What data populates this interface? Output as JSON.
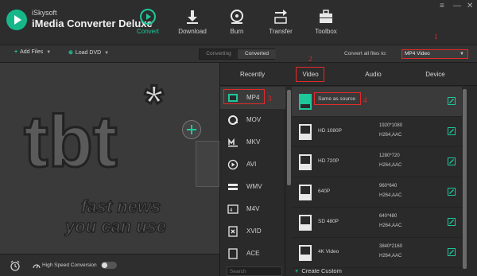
{
  "app": {
    "brand_small": "iSkysoft",
    "brand_big": "iMedia Converter Deluxe",
    "window_controls": [
      "≡",
      "—",
      "✕"
    ]
  },
  "nav": {
    "tabs": [
      {
        "label": "Convert",
        "icon": "convert-icon",
        "active": true
      },
      {
        "label": "Download",
        "icon": "download-icon"
      },
      {
        "label": "Burn",
        "icon": "burn-icon"
      },
      {
        "label": "Transfer",
        "icon": "transfer-icon"
      },
      {
        "label": "Toolbox",
        "icon": "toolbox-icon"
      }
    ]
  },
  "toolbar": {
    "add_files": "Add Files",
    "load_dvd": "Load DVD",
    "converting": "Converting",
    "converted": "Converted",
    "convert_all_label": "Convert all files to:",
    "format_value": "MP4 Video"
  },
  "preview": {
    "logo_text_1": "tbt",
    "logo_text_2": "fast news",
    "logo_text_3": "you can use"
  },
  "panel": {
    "tabs": [
      "Recently",
      "Video",
      "Audio",
      "Device"
    ],
    "formats": [
      {
        "label": "MP4",
        "icon": "mp4-film-icon",
        "selected": true
      },
      {
        "label": "MOV",
        "icon": "mov-icon"
      },
      {
        "label": "MKV",
        "icon": "mkv-icon"
      },
      {
        "label": "AVI",
        "icon": "avi-icon"
      },
      {
        "label": "WMV",
        "icon": "wmv-icon"
      },
      {
        "label": "M4V",
        "icon": "m4v-icon"
      },
      {
        "label": "XVID",
        "icon": "xvid-icon"
      },
      {
        "label": "ACE",
        "icon": "ace-icon"
      }
    ],
    "resolutions": [
      {
        "label": "Same as source",
        "res": "",
        "codec": "",
        "badge": "SOURCE",
        "selected": true
      },
      {
        "label": "HD 1080P",
        "res": "1920*1080",
        "codec": "H264,AAC",
        "badge": "1080P"
      },
      {
        "label": "HD 720P",
        "res": "1280*720",
        "codec": "H264,AAC",
        "badge": "720P"
      },
      {
        "label": "640P",
        "res": "960*640",
        "codec": "H264,AAC",
        "badge": "640P"
      },
      {
        "label": "SD 480P",
        "res": "640*480",
        "codec": "H264,AAC",
        "badge": "480P"
      },
      {
        "label": "4K Video",
        "res": "3840*2160",
        "codec": "H264,AAC",
        "badge": "4K"
      }
    ],
    "search_placeholder": "Search",
    "create_custom": "Create Custom"
  },
  "bottom": {
    "high_speed_label": "High Speed Conversion"
  },
  "annotations": [
    "1",
    "2",
    "3",
    "4"
  ],
  "colors": {
    "accent": "#1ec79a",
    "annotation": "#e12a2a"
  }
}
